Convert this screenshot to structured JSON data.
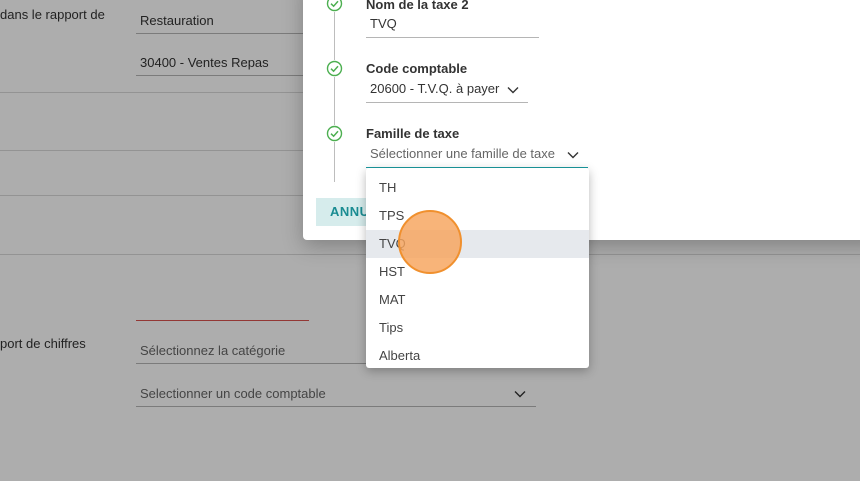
{
  "background": {
    "report_label": "dans le rapport de",
    "category_value": "Restauration",
    "account_value": "30400 - Ventes Repas",
    "figures_report_label": "port de chiffres",
    "category_placeholder": "Sélectionnez la catégorie",
    "account_code_placeholder": "Selectionner un code comptable"
  },
  "modal": {
    "steps": [
      {
        "title": "Nom de la taxe 2",
        "value": "TVQ"
      },
      {
        "title": "Code comptable",
        "value": "20600 - T.V.Q. à payer"
      },
      {
        "title": "Famille de taxe",
        "placeholder": "Sélectionner une famille de taxe"
      }
    ],
    "cancel_label": "ANNULER"
  },
  "dropdown": {
    "options": [
      "TH",
      "TPS",
      "TVQ",
      "HST",
      "MAT",
      "Tips",
      "Alberta"
    ],
    "hovered": "TVQ"
  },
  "colors": {
    "accent": "#1a9aa0",
    "check": "#4caf50",
    "click_indicator": "#f6a45c"
  }
}
